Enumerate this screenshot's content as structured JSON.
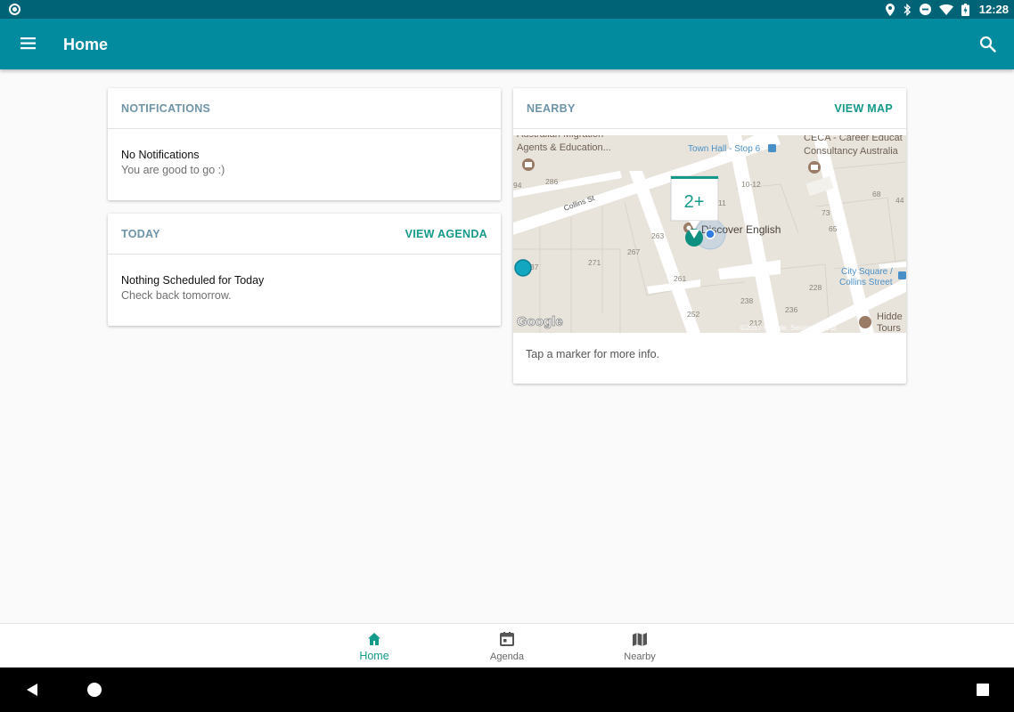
{
  "status_bar": {
    "time": "12:28",
    "icons": [
      "location-icon",
      "bluetooth-icon",
      "do-not-disturb-icon",
      "wifi-icon",
      "battery-charging-icon"
    ]
  },
  "app_bar": {
    "title": "Home",
    "menu_icon": "hamburger-menu-icon",
    "search_icon": "search-icon"
  },
  "notifications_card": {
    "title": "NOTIFICATIONS",
    "primary": "No Notifications",
    "secondary": "You are good to go :)"
  },
  "today_card": {
    "title": "TODAY",
    "action": "VIEW AGENDA",
    "primary": "Nothing Scheduled for Today",
    "secondary": "Check back tomorrow."
  },
  "nearby_card": {
    "title": "NEARBY",
    "action": "VIEW MAP",
    "caption": "Tap a marker for more info.",
    "map": {
      "cluster_label": "2+",
      "street": "Collins St",
      "places": [
        "Australian Migration",
        "Agents & Education...",
        "Town Hall - Stop 6",
        "CECA - Career Educat",
        "Consultancy Australia",
        "Discover English",
        "City Square /",
        "Collins Street",
        "Hidde",
        "Tours"
      ],
      "numbers": [
        "94",
        "286",
        "10-12",
        "68",
        "44",
        "11",
        "73",
        "65",
        "263",
        "267",
        "271",
        "37",
        "261",
        "228",
        "238",
        "236",
        "252",
        "212"
      ],
      "logo": "Google",
      "attribution": "©2017 Google, Sensis Pty Ltd"
    }
  },
  "bottom_nav": {
    "items": [
      {
        "label": "Home",
        "icon": "home-icon",
        "active": true
      },
      {
        "label": "Agenda",
        "icon": "calendar-icon",
        "active": false
      },
      {
        "label": "Nearby",
        "icon": "map-icon",
        "active": false
      }
    ]
  },
  "colors": {
    "status_bar": "#016476",
    "app_bar": "#028a9e",
    "accent": "#14998a",
    "card_title": "#6d94a9"
  }
}
